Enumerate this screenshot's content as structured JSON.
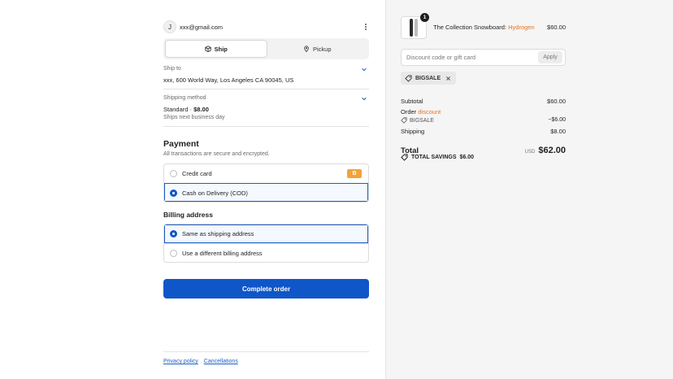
{
  "account": {
    "initial": "J",
    "email": "xxx@gmail.com"
  },
  "delivery_toggle": {
    "ship_label": "Ship",
    "pickup_label": "Pickup"
  },
  "ship_to": {
    "label": "Ship to",
    "address": "xxx, 600 World Way, Los Angeles CA 90045, US"
  },
  "shipping_method": {
    "label": "Shipping method",
    "name": "Standard",
    "separator": " · ",
    "price": "$8.00",
    "note": "Ships next business day"
  },
  "payment": {
    "title": "Payment",
    "subtitle": "All transactions are secure and encrypted.",
    "options": [
      {
        "label": "Credit card",
        "badge": "B",
        "selected": false
      },
      {
        "label": "Cash on Delivery (COD)",
        "selected": true
      }
    ]
  },
  "billing": {
    "title": "Billing address",
    "options": [
      {
        "label": "Same as shipping address",
        "selected": true
      },
      {
        "label": "Use a different billing address",
        "selected": false
      }
    ]
  },
  "complete_button": "Complete order",
  "footer": {
    "links": [
      "Privacy policy",
      "Cancellations"
    ]
  },
  "cart": {
    "item": {
      "name": "The Collection Snowboard: ",
      "variant": "Hydrogen",
      "price": "$60.00",
      "quantity": "1"
    },
    "discount": {
      "placeholder": "Discount code or gift card",
      "apply_label": "Apply"
    },
    "applied_code": "BIGSALE",
    "summary": {
      "subtotal_label": "Subtotal",
      "subtotal_value": "$60.00",
      "order_discount_label": "Order ",
      "order_discount_hl": "discount",
      "discount_code": "BIGSALE",
      "discount_value": "−$6.00",
      "shipping_label": "Shipping",
      "shipping_value": "$8.00",
      "total_label": "Total",
      "currency": "USD",
      "total_value": "$62.00",
      "savings_label": "TOTAL SAVINGS",
      "savings_value": "$6.00"
    }
  },
  "colors": {
    "primary": "#0f56c8",
    "accent": "#e6731f",
    "badge": "#f2a33a"
  }
}
